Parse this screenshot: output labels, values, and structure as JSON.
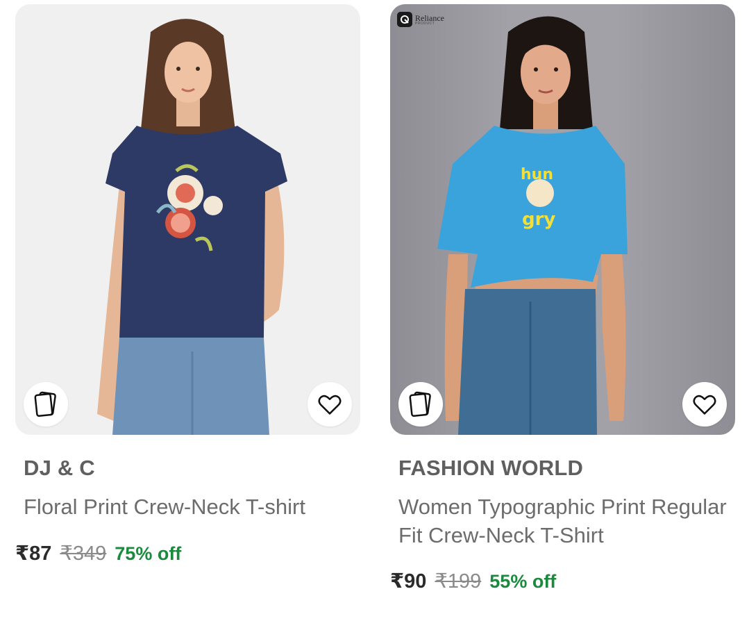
{
  "products": [
    {
      "brand": "DJ & C",
      "title": "Floral Print Crew-Neck T-shirt",
      "price": "₹87",
      "mrp": "₹349",
      "discount": "75% off",
      "image_icon": "model-navy-floral-tshirt",
      "badge": null
    },
    {
      "brand": "FASHION WORLD",
      "title": "Women Typographic Print Regular Fit Crew-Neck T-Shirt",
      "price": "₹90",
      "mrp": "₹199",
      "discount": "55% off",
      "image_icon": "model-blue-hungry-crop-tshirt",
      "badge": {
        "name": "Reliance",
        "sub": "PRODUCT"
      }
    }
  ],
  "icons": {
    "similar": "similar-products-icon",
    "wishlist": "heart-icon"
  },
  "colors": {
    "discount": "#1c8a3e",
    "brand_text": "#5f5f5f",
    "price_text": "#2b2b2b"
  }
}
